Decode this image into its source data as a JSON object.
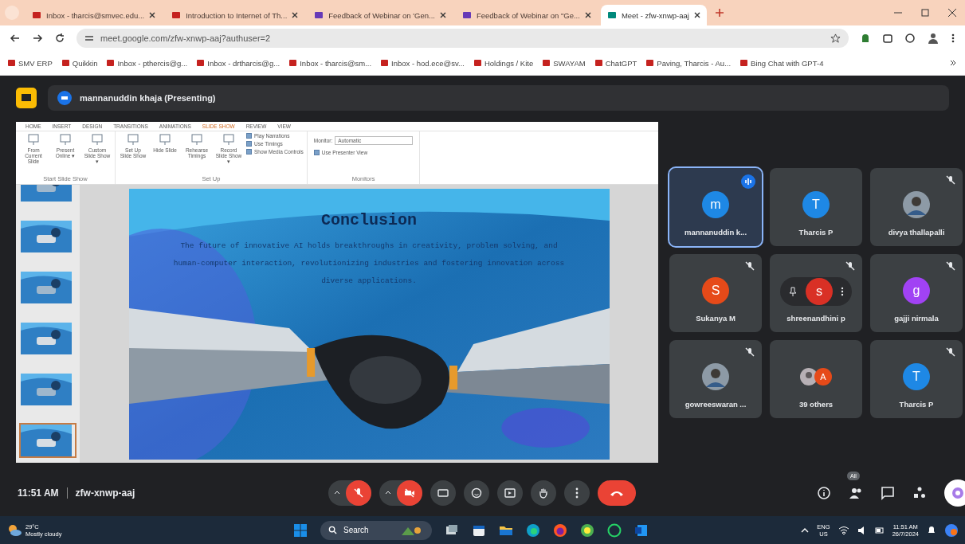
{
  "browser": {
    "tabs": [
      {
        "title": "Inbox - tharcis@smvec.edu...",
        "selected": false
      },
      {
        "title": "Introduction to Internet of Th...",
        "selected": false
      },
      {
        "title": "Feedback of Webinar on 'Gen...",
        "selected": false
      },
      {
        "title": "Feedback of Webinar on \"Ge...",
        "selected": false
      },
      {
        "title": "Meet - zfw-xnwp-aaj",
        "selected": true
      }
    ],
    "address": "meet.google.com/zfw-xnwp-aaj?authuser=2",
    "bookmarks": [
      "SMV ERP",
      "Quikkin",
      "Inbox - pthercis@g...",
      "Inbox - drtharcis@g...",
      "Inbox - tharcis@sm...",
      "Inbox - hod.ece@sv...",
      "Holdings / Kite",
      "SWAYAM",
      "ChatGPT",
      "Paving, Tharcis - Au...",
      "Bing Chat with GPT-4"
    ]
  },
  "meet": {
    "presenter": "mannanuddin khaja (Presenting)",
    "presentation": {
      "ribbon_tabs": [
        {
          "label": "HOME",
          "selected": false
        },
        {
          "label": "INSERT",
          "selected": false
        },
        {
          "label": "DESIGN",
          "selected": false
        },
        {
          "label": "TRANSITIONS",
          "selected": false
        },
        {
          "label": "ANIMATIONS",
          "selected": false
        },
        {
          "label": "SLIDE SHOW",
          "selected": true
        },
        {
          "label": "REVIEW",
          "selected": false
        },
        {
          "label": "VIEW",
          "selected": false
        }
      ],
      "ribbon_groups": [
        {
          "label": "Start Slide Show",
          "buttons": [
            "From Current Slide",
            "Present Online ▾",
            "Custom Slide Show ▾"
          ]
        },
        {
          "label": "Set Up",
          "buttons": [
            "Set Up Slide Show",
            "Hide Slide",
            "Rehearse Timings",
            "Record Slide Show ▾"
          ],
          "options": [
            {
              "label": "Play Narrations",
              "checked": true
            },
            {
              "label": "Use Timings",
              "checked": true
            },
            {
              "label": "Show Media Controls",
              "checked": true
            }
          ]
        },
        {
          "label": "Monitors",
          "monitor_label": "Monitor:",
          "monitor_value": "Automatic",
          "options": [
            {
              "label": "Use Presenter View",
              "checked": true
            }
          ]
        }
      ],
      "thumbnails": [
        {
          "kind": "picture",
          "selected": false
        },
        {
          "kind": "picture",
          "selected": false
        },
        {
          "kind": "picture",
          "selected": false
        },
        {
          "kind": "picture",
          "selected": false
        },
        {
          "kind": "picture",
          "selected": false
        },
        {
          "kind": "picture",
          "selected": true
        }
      ],
      "slide": {
        "title": "Conclusion",
        "body": "The future of innovative AI holds breakthroughs in creativity, problem solving, and human-computer interaction, revolutionizing industries and fostering innovation across diverse applications."
      }
    },
    "participants": [
      {
        "name": "mannanuddin k...",
        "kind": "letter",
        "initial": "m",
        "color": "#1e88e5",
        "muted": false,
        "speaking": true,
        "hovered": false
      },
      {
        "name": "Tharcis P",
        "kind": "letter",
        "initial": "T",
        "color": "#1e88e5",
        "muted": false,
        "speaking": false,
        "hovered": false
      },
      {
        "name": "divya thallapalli",
        "muted": true,
        "speaking": false,
        "hovered": false
      },
      {
        "name": "Sukanya M",
        "kind": "letter",
        "initial": "S",
        "color": "#e64a19",
        "muted": true,
        "speaking": false,
        "hovered": false
      },
      {
        "name": "shreenandhini p",
        "kind": "letter",
        "initial": "s",
        "color": "#d93025",
        "muted": true,
        "speaking": false,
        "hovered": true
      },
      {
        "name": "gajji nirmala",
        "kind": "letter",
        "initial": "g",
        "color": "#a142f4",
        "muted": true,
        "speaking": false,
        "hovered": false
      },
      {
        "name": "gowreeswaran ...",
        "muted": true,
        "speaking": false,
        "hovered": false
      },
      {
        "name": "39 others",
        "kind": "group",
        "initial": "A",
        "color": "#e64a19",
        "muted": false,
        "speaking": false,
        "hovered": false
      },
      {
        "name": "Tharcis P",
        "kind": "letter",
        "initial": "T",
        "color": "#1e88e5",
        "muted": true,
        "speaking": false,
        "hovered": false
      }
    ],
    "bottom": {
      "time": "11:51 AM",
      "code": "zfw-xnwp-aaj",
      "mic_on": false,
      "camera_on": false,
      "people_badge": "All"
    }
  },
  "taskbar": {
    "temperature": "29°C",
    "weather": "Mostly cloudy",
    "search": "Search",
    "language": "ENG",
    "region": "US",
    "time": "11:51 AM",
    "date": "26/7/2024"
  }
}
